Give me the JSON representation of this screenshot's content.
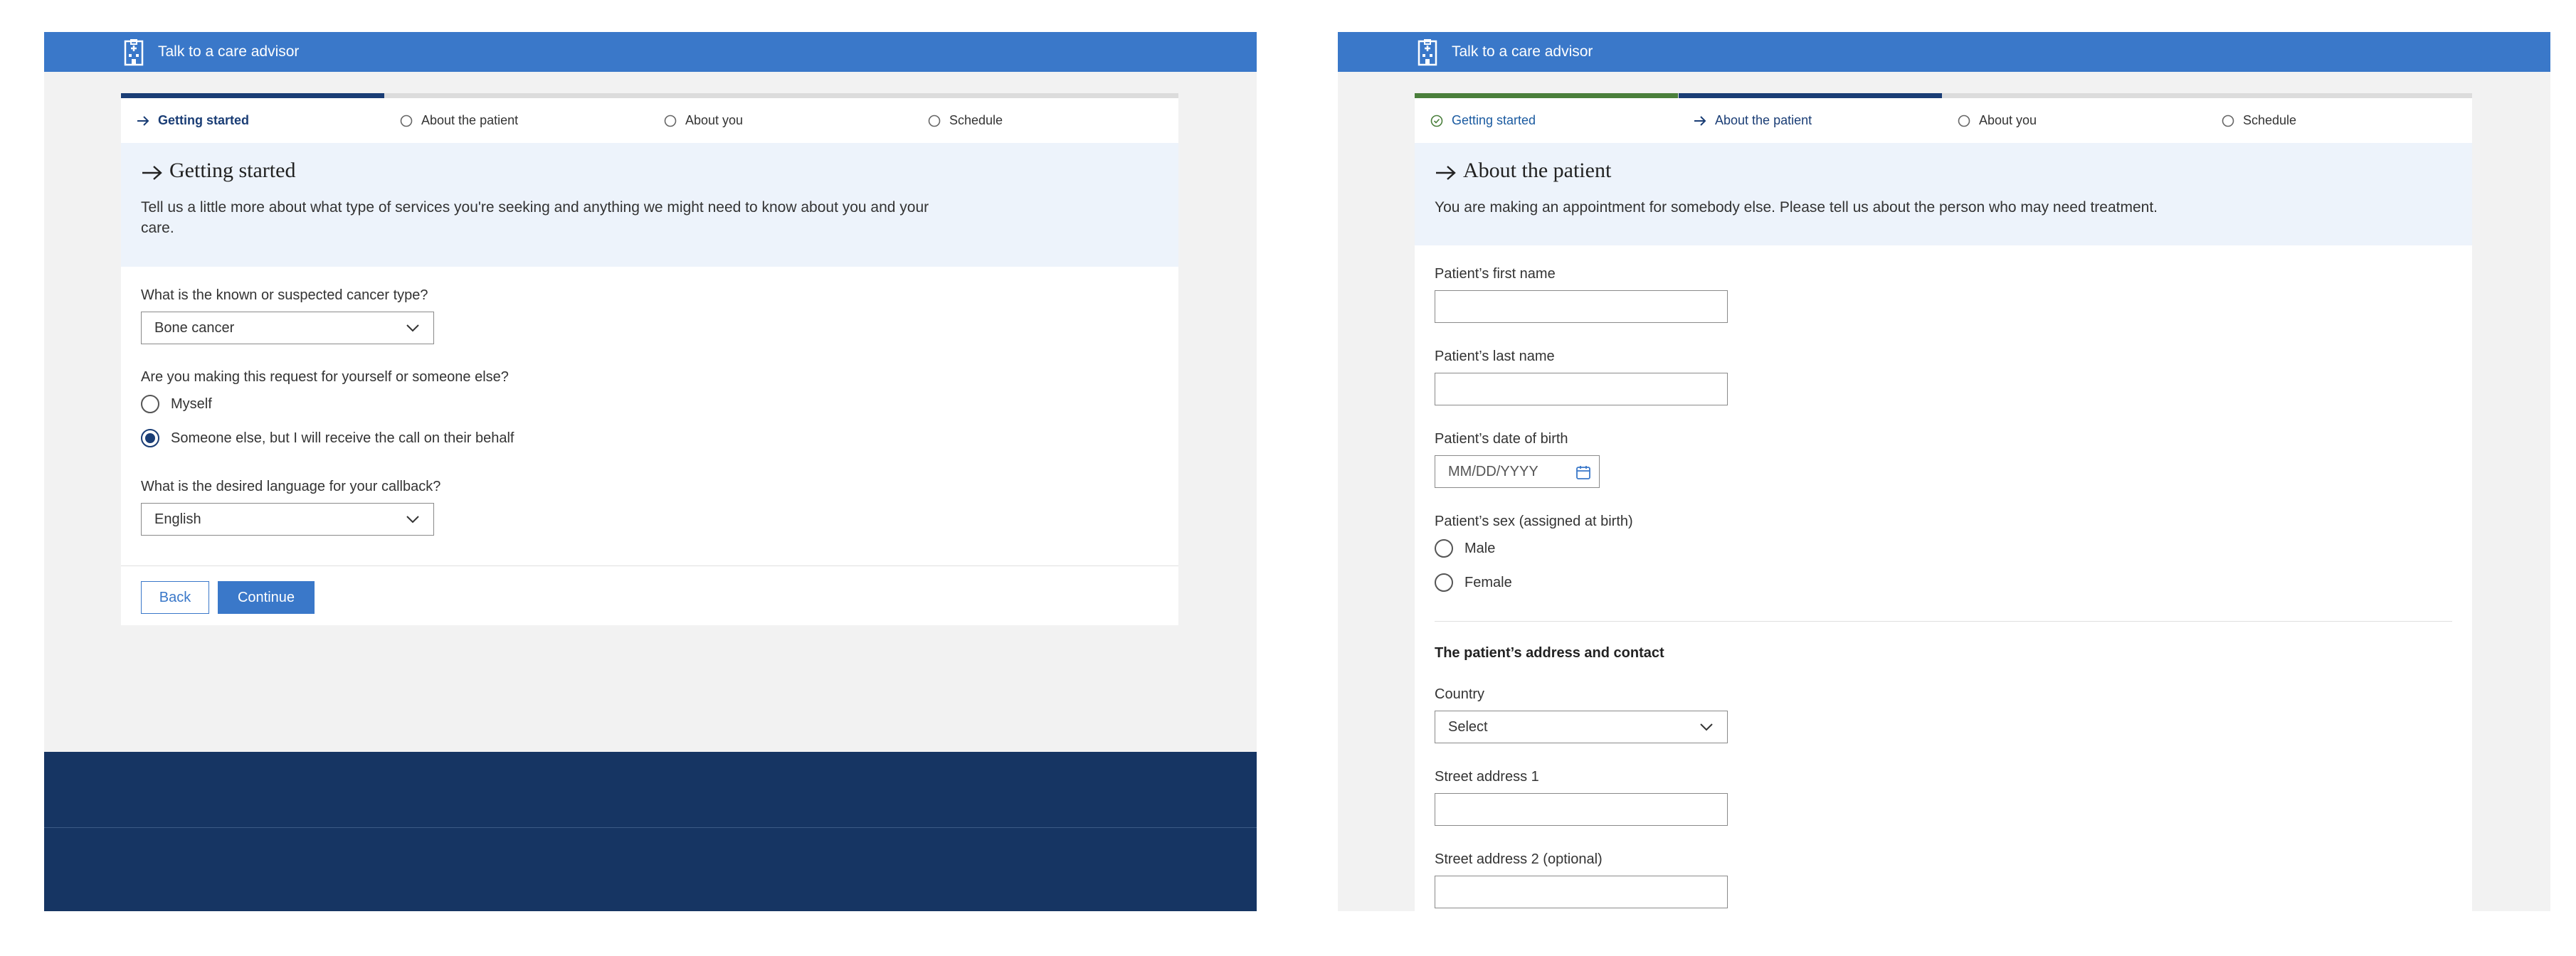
{
  "header": {
    "title": "Talk to a care advisor",
    "icon": "hospital-icon"
  },
  "colors": {
    "brand_blue": "#3a78c9",
    "navy": "#163563",
    "step_active": "#1a3d75",
    "step_done": "#4a7f3b",
    "hero_bg": "#edf3fb"
  },
  "left": {
    "steps": [
      {
        "label": "Getting started",
        "state": "active",
        "icon": "arrow-right-icon"
      },
      {
        "label": "About the patient",
        "state": "pending",
        "icon": "circle-icon"
      },
      {
        "label": "About you",
        "state": "pending",
        "icon": "circle-icon"
      },
      {
        "label": "Schedule",
        "state": "pending",
        "icon": "circle-icon"
      }
    ],
    "hero": {
      "title": "Getting started",
      "description": "Tell us a little more about what type of services you're seeking and anything we might need to know about you and your care."
    },
    "cancer_type": {
      "label": "What is the known or suspected cancer type?",
      "value": "Bone cancer"
    },
    "request_for": {
      "label": "Are you making this request for yourself or someone else?",
      "options": [
        {
          "label": "Myself",
          "selected": false
        },
        {
          "label": "Someone else, but I will receive the call on their behalf",
          "selected": true
        }
      ]
    },
    "language": {
      "label": "What is the desired language for your callback?",
      "value": "English"
    },
    "buttons": {
      "back": "Back",
      "continue": "Continue"
    }
  },
  "right": {
    "steps": [
      {
        "label": "Getting started",
        "state": "done",
        "icon": "check-circle-icon"
      },
      {
        "label": "About the patient",
        "state": "active",
        "icon": "arrow-right-icon"
      },
      {
        "label": "About you",
        "state": "pending",
        "icon": "circle-icon"
      },
      {
        "label": "Schedule",
        "state": "pending",
        "icon": "circle-icon"
      }
    ],
    "hero": {
      "title": "About the patient",
      "description": "You are making an appointment for somebody else. Please tell us about the person who may need treatment."
    },
    "first_name": {
      "label": "Patient’s first name",
      "value": ""
    },
    "last_name": {
      "label": "Patient’s last name",
      "value": ""
    },
    "dob": {
      "label": "Patient’s date of birth",
      "placeholder": "MM/DD/YYYY"
    },
    "sex": {
      "label": "Patient’s sex (assigned at birth)",
      "options": [
        {
          "label": "Male",
          "selected": false
        },
        {
          "label": "Female",
          "selected": false
        }
      ]
    },
    "address_section_title": "The patient’s address and contact",
    "country": {
      "label": "Country",
      "value": "Select"
    },
    "street1": {
      "label": "Street address 1",
      "value": ""
    },
    "street2": {
      "label": "Street address 2 (optional)",
      "value": ""
    }
  }
}
